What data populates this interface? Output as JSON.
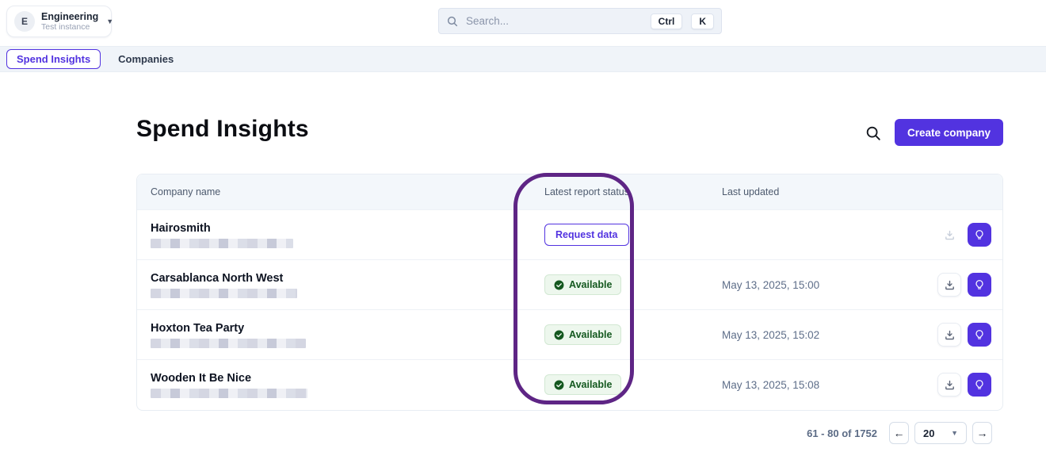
{
  "workspace": {
    "initial": "E",
    "name": "Engineering",
    "subtitle": "Test instance"
  },
  "search": {
    "placeholder": "Search...",
    "shortcut_key_1": "Ctrl",
    "shortcut_key_2": "K"
  },
  "nav": {
    "tab_spend_insights": "Spend Insights",
    "tab_companies": "Companies"
  },
  "page": {
    "title": "Spend Insights",
    "create_button_label": "Create company"
  },
  "table": {
    "columns": {
      "name": "Company name",
      "status": "Latest report status",
      "updated": "Last updated"
    },
    "rows": [
      {
        "name": "Hairosmith",
        "status": "Request data",
        "status_type": "request",
        "last_updated": "",
        "download_enabled": false
      },
      {
        "name": "Carsablanca North West",
        "status": "Available",
        "status_type": "available",
        "last_updated": "May 13, 2025, 15:00",
        "download_enabled": true
      },
      {
        "name": "Hoxton Tea Party",
        "status": "Available",
        "status_type": "available",
        "last_updated": "May 13, 2025, 15:02",
        "download_enabled": true
      },
      {
        "name": "Wooden It Be Nice",
        "status": "Available",
        "status_type": "available",
        "last_updated": "May 13, 2025, 15:08",
        "download_enabled": true
      }
    ]
  },
  "pagination": {
    "range_text": "61 - 80 of 1752",
    "page_size": "20",
    "prev": "←",
    "next": "→"
  },
  "annotation": {
    "shape": "rounded-rectangle",
    "target": "Latest report status column",
    "color": "#5e2585"
  },
  "icons": {
    "workspace_caret": "caret-down-icon",
    "search": "magnifier-icon",
    "download": "download-tray-icon",
    "insights": "lightbulb-icon",
    "available_check": "check-circle-icon"
  },
  "colors": {
    "accent_purple": "#5233e0",
    "annotation_purple": "#5e2585",
    "available_green_text": "#14581f",
    "available_green_bg": "#edf7ed",
    "nav_bg": "#f0f4f9",
    "table_header_bg": "#f3f7fb"
  }
}
